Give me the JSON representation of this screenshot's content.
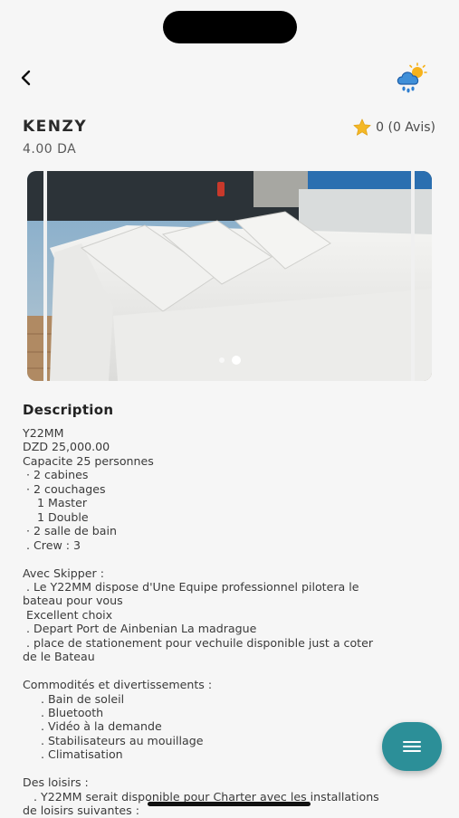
{
  "header": {
    "title": "KENZY",
    "price": "4.00 DA",
    "rating": "0 (0 Avis)"
  },
  "colors": {
    "accent": "#2c8f98",
    "star": "#f4b826"
  },
  "icons": {
    "back": "chevron-left-icon",
    "weather": "weather-rain-sun-icon",
    "star": "star-icon",
    "menu": "menu-icon"
  },
  "carousel": {
    "slide_count": 2,
    "active_index": 1
  },
  "description": {
    "title": "Description",
    "lines": [
      "Y22MM",
      "DZD 25,000.00",
      "Capacite 25 personnes",
      " · 2 cabines",
      " · 2 couchages",
      "    1 Master",
      "    1 Double",
      " · 2 salle de bain",
      " . Crew : 3",
      "",
      "Avec Skipper :",
      " . Le Y22MM dispose d'Une Equipe professionnel pilotera le",
      "bateau pour vous",
      " Excellent choix",
      " . Depart Port de Ainbenian La madrague",
      " . place de stationement pour vechuile disponible just a coter",
      "de le Bateau",
      "",
      "Commodités et divertissements :",
      "     . Bain de soleil",
      "     . Bluetooth",
      "     . Vidéo à la demande",
      "     . Stabilisateurs au mouillage",
      "     . Climatisation",
      "",
      "Des loisirs :",
      "   . Y22MM serait disponible pour Charter avec les installations",
      "de loisirs suivantes :"
    ]
  }
}
